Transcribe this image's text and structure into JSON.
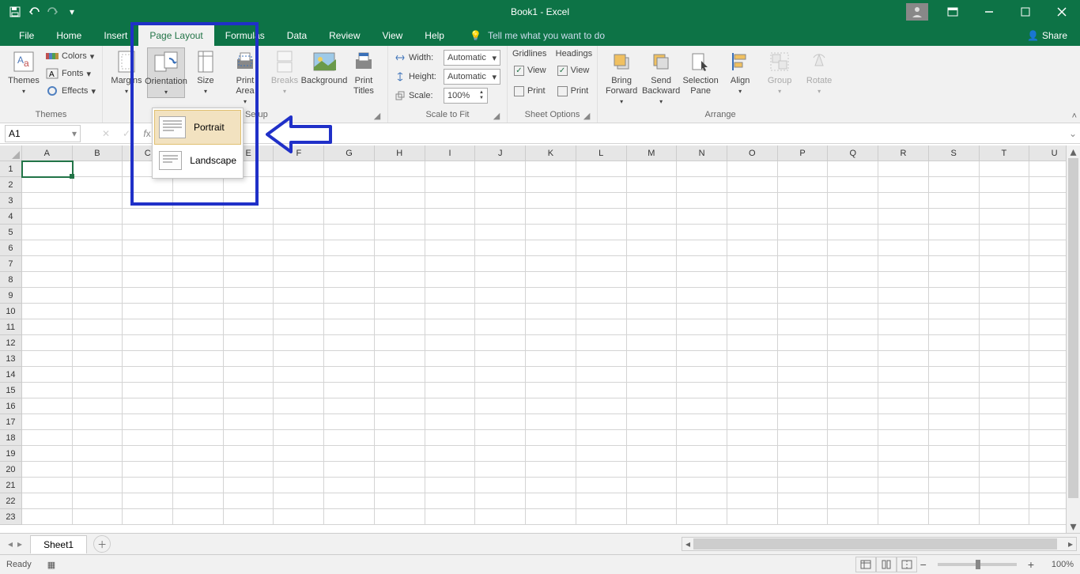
{
  "title": "Book1  -  Excel",
  "tabs": [
    "File",
    "Home",
    "Insert",
    "Page Layout",
    "Formulas",
    "Data",
    "Review",
    "View",
    "Help"
  ],
  "active_tab": "Page Layout",
  "tellme": "Tell me what you want to do",
  "share": "Share",
  "ribbon": {
    "themes": {
      "label": "Themes",
      "themes": "Themes",
      "colors": "Colors",
      "fonts": "Fonts",
      "effects": "Effects"
    },
    "page_setup": {
      "label": "Page Setup",
      "margins": "Margins",
      "orientation": "Orientation",
      "size": "Size",
      "print_area": "Print\nArea",
      "breaks": "Breaks",
      "background": "Background",
      "print_titles": "Print\nTitles"
    },
    "scale": {
      "label": "Scale to Fit",
      "width": "Width:",
      "height": "Height:",
      "scale": "Scale:",
      "width_val": "Automatic",
      "height_val": "Automatic",
      "scale_val": "100%"
    },
    "sheet_options": {
      "label": "Sheet Options",
      "gridlines": "Gridlines",
      "headings": "Headings",
      "view": "View",
      "print": "Print"
    },
    "arrange": {
      "label": "Arrange",
      "bring_forward": "Bring\nForward",
      "send_backward": "Send\nBackward",
      "selection_pane": "Selection\nPane",
      "align": "Align",
      "group": "Group",
      "rotate": "Rotate"
    }
  },
  "orientation_menu": {
    "portrait": "Portrait",
    "landscape": "Landscape"
  },
  "namebox": "A1",
  "columns": [
    "A",
    "B",
    "C",
    "D",
    "E",
    "F",
    "G",
    "H",
    "I",
    "J",
    "K",
    "L",
    "M",
    "N",
    "O",
    "P",
    "Q",
    "R",
    "S",
    "T",
    "U"
  ],
  "row_count": 23,
  "selected_cell": "A1",
  "sheet": "Sheet1",
  "status": "Ready",
  "zoom": "100%"
}
